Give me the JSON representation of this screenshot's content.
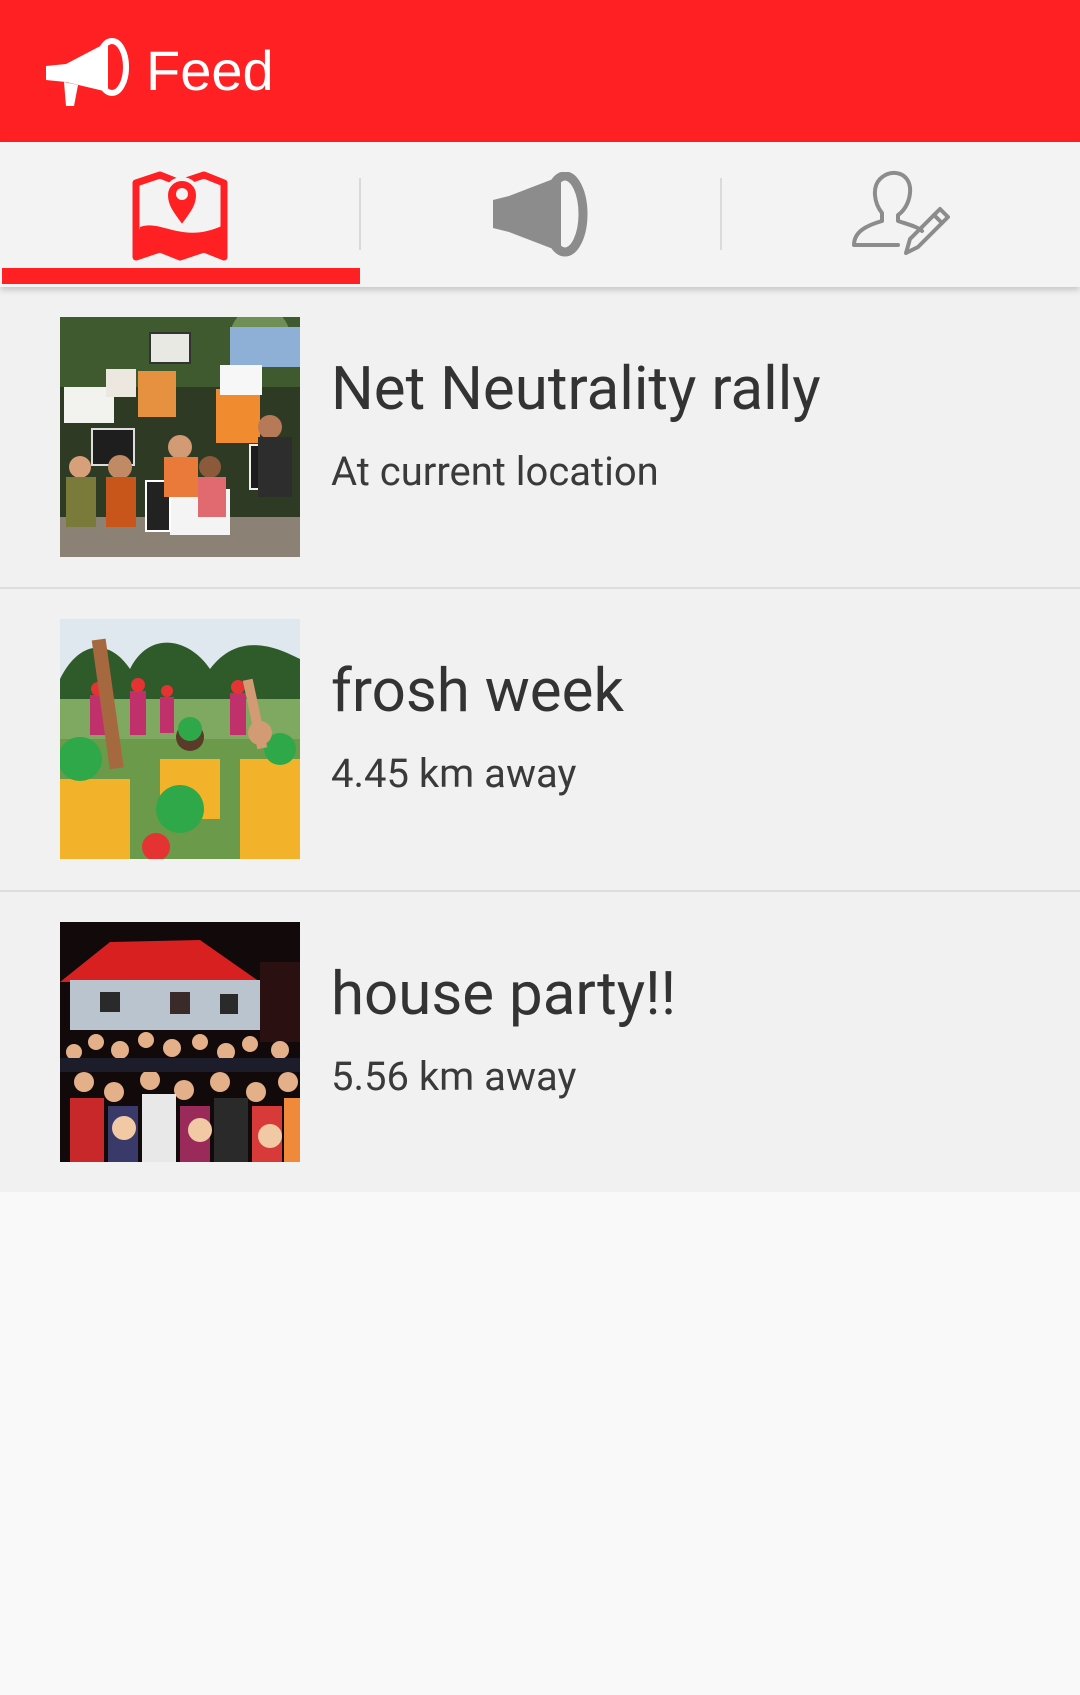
{
  "header": {
    "title": "Feed",
    "logo_icon": "megaphone-icon"
  },
  "tabs": [
    {
      "icon": "map-pin-icon",
      "selected": true
    },
    {
      "icon": "megaphone-icon",
      "selected": false
    },
    {
      "icon": "edit-profile-icon",
      "selected": false
    }
  ],
  "colors": {
    "accent": "#ff2023",
    "tab_icon_inactive": "#8c8c8c"
  },
  "feed": {
    "items": [
      {
        "title": "Net Neutrality rally",
        "subtitle": "At current location",
        "image": "protest-photo"
      },
      {
        "title": "frosh week",
        "subtitle": "4.45 km away",
        "image": "crowd-photo"
      },
      {
        "title": "house party!!",
        "subtitle": "5.56 km away",
        "image": "party-photo"
      }
    ]
  }
}
